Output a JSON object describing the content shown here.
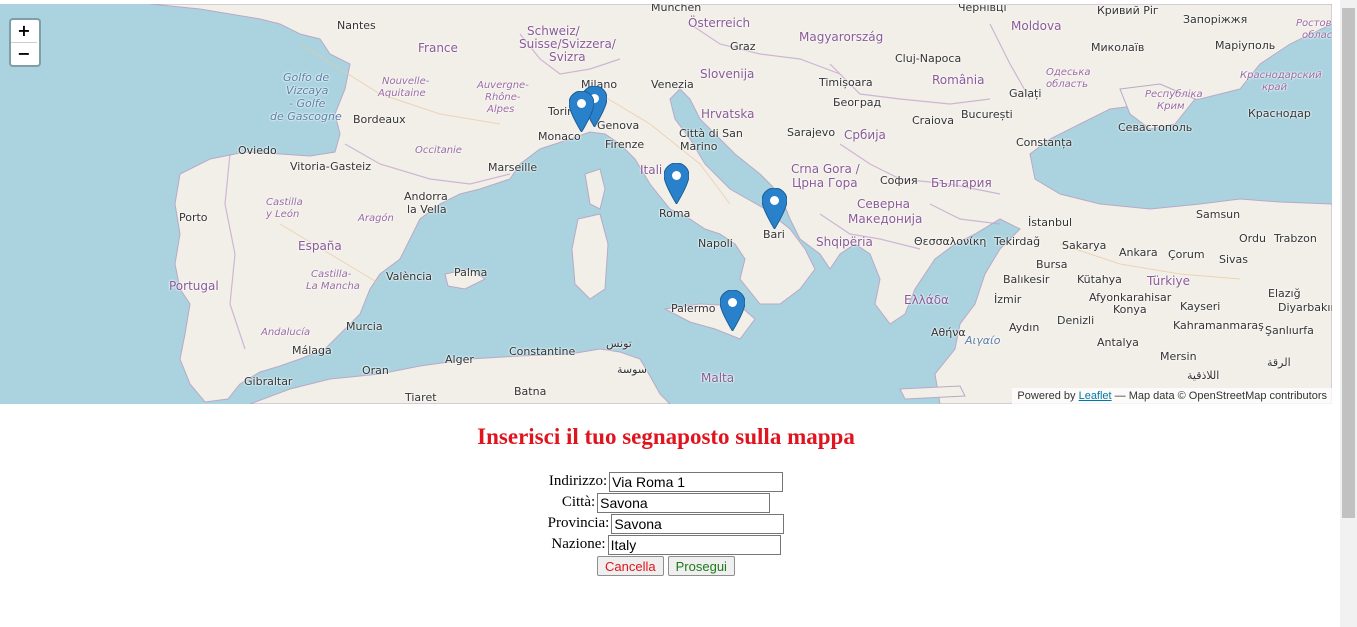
{
  "map": {
    "zoom_in": "+",
    "zoom_out": "−",
    "attribution": {
      "prefix": "Powered by",
      "link": "Leaflet",
      "suffix": "— Map data © OpenStreetMap contributors"
    },
    "labels": {
      "nantes": "Nantes",
      "france": "France",
      "schweiz1": "Schweiz/",
      "schweiz2": "Suisse/Svizzera/",
      "schweiz3": "Svizra",
      "osterreich": "Österreich",
      "graz": "Graz",
      "magyar": "Magyarország",
      "moldova": "Moldova",
      "cluj": "Cluj-Napoca",
      "golfo1": "Golfo de",
      "golfo2": "Vizcaya",
      "golfo3": "- Golfe",
      "golfo4": "de Gascogne",
      "nouvelle1": "Nouvelle-",
      "nouvelle2": "Aquitaine",
      "auvergne1": "Auvergne-",
      "auvergne2": "Rhône-",
      "auvergne3": "Alpes",
      "milano": "Milano",
      "venezia": "Venezia",
      "slovenija": "Slovenija",
      "timisoara": "Timișoara",
      "romania": "România",
      "mykolaiv": "Миколаїв",
      "odesa1": "Одеська",
      "odesa2": "область",
      "krym1": "Республіка",
      "krym2": "Крим",
      "zaporizhzhia": "Запоріжжя",
      "mariupol": "Маріуполь",
      "krasnodarkrai1": "Краснодарский",
      "krasnodarkrai2": "край",
      "bordeaux": "Bordeaux",
      "torino": "Torino",
      "genova": "Genova",
      "hrvatska": "Hrvatska",
      "beograd": "Београд",
      "galati": "Galați",
      "bucuresti": "București",
      "sevastopol": "Севастополь",
      "krasnodar": "Краснодар",
      "monaco": "Monaco",
      "sanmarino1": "Città di San",
      "sanmarino2": "Marino",
      "sarajevo": "Sarajevo",
      "craiova": "Craiova",
      "oviedo": "Oviedo",
      "occitanie": "Occitanie",
      "firenze": "Firenze",
      "srbija": "Србија",
      "constanta": "Constanța",
      "vitoria": "Vitoria-Gasteiz",
      "marseille": "Marseille",
      "italia": "Itali",
      "crnagora1": "Crna Gora /",
      "crnagora2": "Црна Гора",
      "sofia": "София",
      "bulgaria": "България",
      "andorra1": "Andorra",
      "andorra2": "la Vella",
      "castilla1": "Castilla",
      "castilla2": "y León",
      "porto": "Porto",
      "roma": "Roma",
      "aragon": "Aragón",
      "makedonija1": "Северна",
      "makedonija2": "Македонија",
      "bari": "Bari",
      "istanbul": "İstanbul",
      "samsun": "Samsun",
      "ordu": "Ordu",
      "trabzon": "Trabzon",
      "espana": "España",
      "napoli": "Napoli",
      "shqiperia": "Shqipëria",
      "thessaloniki": "Θεσσαλονίκη",
      "tekirdag": "Tekirdağ",
      "sakarya": "Sakarya",
      "ankara": "Ankara",
      "corum": "Çorum",
      "sivas": "Sivas",
      "valencia": "València",
      "palma": "Palma",
      "castillamancha1": "Castilla-",
      "castillamancha2": "La Mancha",
      "portugal": "Portugal",
      "balikesir": "Balıkesir",
      "bursa": "Bursa",
      "kutahya": "Kütahya",
      "turkiye": "Türkiye",
      "palermo": "Palermo",
      "ellada": "Ελλάδα",
      "izmir": "İzmir",
      "afyon": "Afyonkarahisar",
      "kayseri": "Kayseri",
      "elazig": "Elazığ",
      "murcia": "Murcia",
      "andalucia": "Andalucía",
      "athina": "Αθήνα",
      "aigaio": "Αιγαίο",
      "aydin": "Aydın",
      "denizli": "Denizli",
      "konya": "Konya",
      "kahramanmaras": "Kahramanmaraş",
      "diyarbakir": "Diyarbakır",
      "sanliurfa": "Şanlıurfa",
      "malaga": "Málaga",
      "constantine": "Constantine",
      "tunis": "تونس",
      "antalya": "Antalya",
      "mersin": "Mersin",
      "gibraltar": "Gibraltar",
      "oran": "Oran",
      "alger": "Alger",
      "sousse": "سوسة",
      "malta": "Malta",
      "raqqa": "الرقة",
      "latakia": "اللاذقية",
      "tiaret": "Tiaret",
      "batna": "Batna",
      "chernivtsi": "Чернівці",
      "krivyirih": "Кривий Ріг",
      "rostov1": "Ростов",
      "rostov2": "облас",
      "munchen": "München"
    }
  },
  "form": {
    "title": "Inserisci il tuo segnaposto sulla mappa",
    "fields": {
      "indirizzo": {
        "label": "Indirizzo:",
        "value": "Via Roma 1"
      },
      "citta": {
        "label": "Città:",
        "value": "Savona"
      },
      "provincia": {
        "label": "Provincia:",
        "value": "Savona"
      },
      "nazione": {
        "label": "Nazione:",
        "value": "Italy"
      }
    },
    "buttons": {
      "cancel": "Cancella",
      "next": "Prosegui"
    }
  },
  "colors": {
    "title": "#e0141e",
    "cancel": "#e0141e",
    "next": "#1a7a1a",
    "sea": "#aad3df",
    "land": "#f2efe9",
    "marker": "#2a81cb"
  },
  "markers": [
    "genova-marker",
    "roma-marker",
    "bari-marker",
    "sicilia-marker"
  ]
}
